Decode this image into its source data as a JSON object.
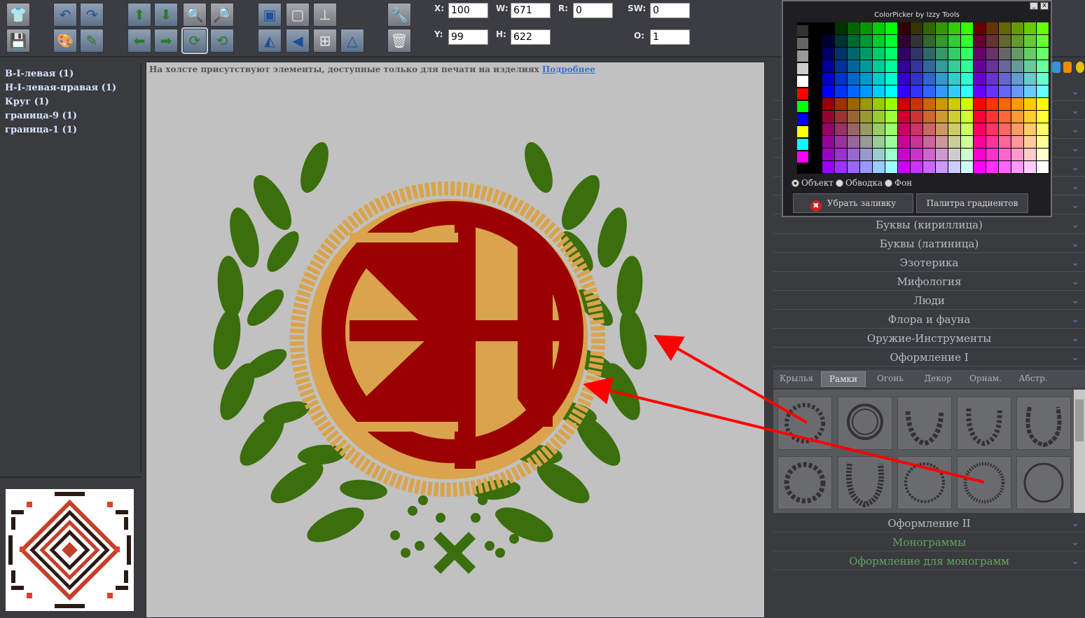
{
  "toolbar": {
    "x_label": "X:",
    "x_value": "100",
    "y_label": "Y:",
    "y_value": "99",
    "w_label": "W:",
    "w_value": "671",
    "h_label": "H:",
    "h_value": "622",
    "r_label": "R:",
    "r_value": "0",
    "sw_label": "SW:",
    "sw_value": "0",
    "o_label": "O:",
    "o_value": "1"
  },
  "layers": [
    "В-I-левая (1)",
    "Н-I-левая-правая (1)",
    "Круг (1)",
    "граница-9 (1)",
    "граница-1 (1)"
  ],
  "canvas": {
    "notice": "На холсте присутствуют элементы, доступные только для печати на изделиях",
    "notice_link": "Подробнее"
  },
  "color_picker": {
    "title": "ColorPicker by Izzy Tools",
    "minimize": "_",
    "close": "x",
    "radio_object": "Объект",
    "radio_stroke": "Обводка",
    "radio_background": "Фон",
    "remove_fill": "Убрать заливку",
    "gradient_palette": "Палитра градиентов"
  },
  "categories": [
    "Буквы (кириллица)",
    "Буквы (латиница)",
    "Эзотерика",
    "Мифология",
    "Люди",
    "Флора и фауна",
    "Оружие-Инструменты",
    "Оформление I"
  ],
  "subtabs": [
    "Крылья",
    "Рамки",
    "Огонь",
    "Декор",
    "Орнам.",
    "Абстр."
  ],
  "categories_bottom": [
    "Оформление II",
    "Монограммы",
    "Оформление для монограмм"
  ],
  "colors": {
    "canvas": "#c1c1c1",
    "monogram_red": "#9b0000",
    "rope_gold": "#d9a44c",
    "laurel_green": "#3b6e0c",
    "arrow_red": "#ff0000"
  }
}
